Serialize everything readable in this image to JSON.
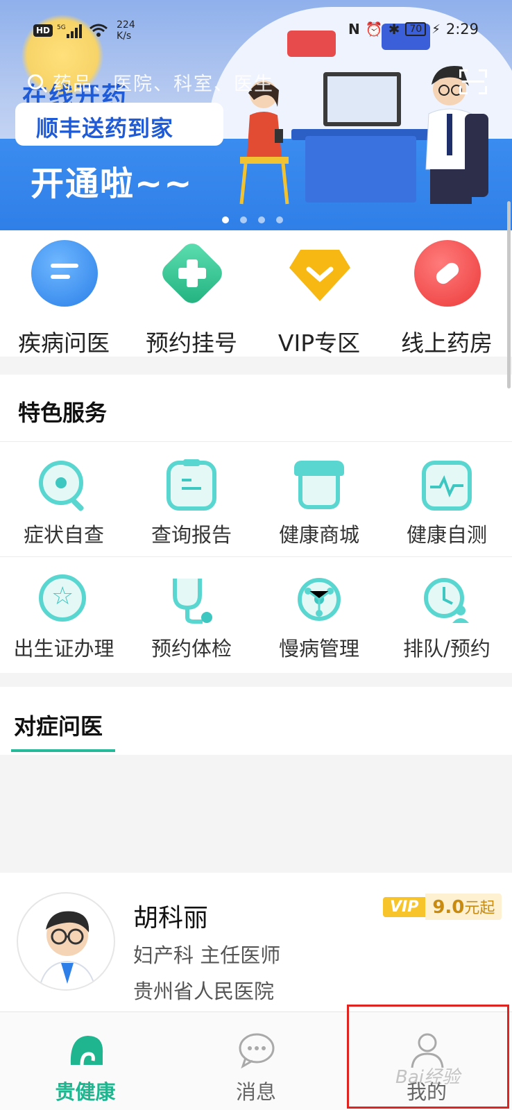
{
  "status_bar": {
    "hd": "HD",
    "signal": "5G",
    "net_speed_value": "224",
    "net_speed_unit": "K/s",
    "battery": "70",
    "time": "2:29"
  },
  "search": {
    "placeholder": "药品、医院、科室、医生"
  },
  "banner": {
    "title": "在线开药",
    "subtitle": "顺丰送药到家",
    "headline": "开通啦~~",
    "dots": 4,
    "active_dot": 1
  },
  "quick_entries": [
    {
      "label": "疾病问医",
      "icon": "chat-bubble-icon",
      "color": "#3d8ff0"
    },
    {
      "label": "预约挂号",
      "icon": "plus-cross-icon",
      "color": "#2fc08c"
    },
    {
      "label": "VIP专区",
      "icon": "vip-chevron-icon",
      "color": "#f7b814"
    },
    {
      "label": "线上药房",
      "icon": "pill-icon",
      "color": "#f24646"
    }
  ],
  "services": {
    "title": "特色服务",
    "items": [
      {
        "label": "症状自查",
        "icon": "magnifier-icon"
      },
      {
        "label": "查询报告",
        "icon": "clipboard-icon"
      },
      {
        "label": "健康商城",
        "icon": "shop-icon"
      },
      {
        "label": "健康自测",
        "icon": "heartbeat-icon"
      },
      {
        "label": "出生证办理",
        "icon": "star-badge-icon"
      },
      {
        "label": "预约体检",
        "icon": "stethoscope-icon"
      },
      {
        "label": "慢病管理",
        "icon": "network-icon"
      },
      {
        "label": "排队/预约",
        "icon": "clock-person-icon"
      }
    ]
  },
  "consult": {
    "tab": "对症问医"
  },
  "doctor": {
    "name": "胡科丽",
    "dept": "妇产科  主任医师",
    "hospital": "贵州省人民医院",
    "vip": "VIP",
    "price": "9.0",
    "price_suffix": "元起"
  },
  "nav": [
    {
      "label": "贵健康",
      "icon": "home-logo-icon",
      "active": true
    },
    {
      "label": "消息",
      "icon": "message-icon",
      "active": false
    },
    {
      "label": "我的",
      "icon": "user-icon",
      "active": false
    }
  ],
  "watermark": "Bai经验",
  "colors": {
    "accent": "#1fb58f",
    "highlight": "#e0231f"
  }
}
